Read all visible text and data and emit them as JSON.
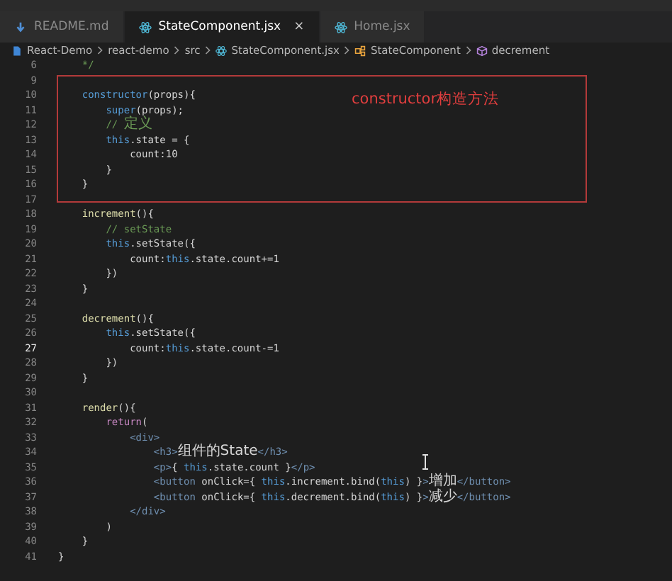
{
  "tabs": [
    {
      "label": "README.md",
      "kind": "md",
      "selected": false
    },
    {
      "label": "StateComponent.jsx",
      "kind": "jsx",
      "selected": true,
      "close": "×"
    },
    {
      "label": "Home.jsx",
      "kind": "jsx",
      "selected": false
    }
  ],
  "breadcrumb": [
    {
      "label": "React-Demo",
      "kind": "file"
    },
    {
      "label": "react-demo",
      "kind": "plain"
    },
    {
      "label": "src",
      "kind": "plain"
    },
    {
      "label": "StateComponent.jsx",
      "kind": "jsx"
    },
    {
      "label": "StateComponent",
      "kind": "class"
    },
    {
      "label": "decrement",
      "kind": "method"
    }
  ],
  "annotation": {
    "text": "constructor构造方法"
  },
  "code_lines": [
    {
      "n": "6",
      "active": false,
      "tokens": [
        {
          "t": "    */",
          "kind": "comment"
        }
      ]
    },
    {
      "n": "9",
      "active": false
    },
    {
      "n": "10",
      "active": false,
      "tokens": [
        {
          "t": "    constructor",
          "kind": "kw"
        },
        {
          "t": "(props){",
          "kind": "plain"
        }
      ]
    },
    {
      "n": "11",
      "active": false,
      "tokens": [
        {
          "t": "        super",
          "kind": "kw"
        },
        {
          "t": "(props);",
          "kind": "plain"
        }
      ]
    },
    {
      "n": "12",
      "active": false,
      "tokens": [
        {
          "t": "        // ",
          "kind": "comment"
        },
        {
          "t": "定义",
          "kind": "comment"
        }
      ]
    },
    {
      "n": "13",
      "active": false,
      "tokens": [
        {
          "t": "        this",
          "kind": "kw"
        },
        {
          "t": ".state = {",
          "kind": "plain"
        }
      ]
    },
    {
      "n": "14",
      "active": false,
      "tokens": [
        {
          "t": "            count:10",
          "kind": "plain"
        }
      ]
    },
    {
      "n": "15",
      "active": false,
      "tokens": [
        {
          "t": "        }",
          "kind": "plain"
        }
      ]
    },
    {
      "n": "16",
      "active": false,
      "tokens": [
        {
          "t": "    }",
          "kind": "plain"
        }
      ]
    },
    {
      "n": "17",
      "active": false
    },
    {
      "n": "18",
      "active": false,
      "tokens": [
        {
          "t": "    increment",
          "kind": "fn"
        },
        {
          "t": "(){",
          "kind": "plain"
        }
      ]
    },
    {
      "n": "19",
      "active": false,
      "tokens": [
        {
          "t": "        // setState",
          "kind": "comment"
        }
      ]
    },
    {
      "n": "20",
      "active": false,
      "tokens": [
        {
          "t": "        this",
          "kind": "kw"
        },
        {
          "t": ".setState({",
          "kind": "plain"
        }
      ]
    },
    {
      "n": "21",
      "active": false,
      "tokens": [
        {
          "t": "            count:",
          "kind": "plain"
        },
        {
          "t": "this",
          "kind": "kw"
        },
        {
          "t": ".state.count+=1",
          "kind": "plain"
        }
      ]
    },
    {
      "n": "22",
      "active": false,
      "tokens": [
        {
          "t": "        })",
          "kind": "plain"
        }
      ]
    },
    {
      "n": "23",
      "active": false,
      "tokens": [
        {
          "t": "    }",
          "kind": "plain"
        }
      ]
    },
    {
      "n": "24",
      "active": false
    },
    {
      "n": "25",
      "active": false,
      "tokens": [
        {
          "t": "    decrement",
          "kind": "fn"
        },
        {
          "t": "(){",
          "kind": "plain"
        }
      ]
    },
    {
      "n": "26",
      "active": false,
      "tokens": [
        {
          "t": "        this",
          "kind": "kw"
        },
        {
          "t": ".setState({",
          "kind": "plain"
        }
      ]
    },
    {
      "n": "27",
      "active": true,
      "tokens": [
        {
          "t": "            count:",
          "kind": "plain"
        },
        {
          "t": "this",
          "kind": "kw"
        },
        {
          "t": ".state.count-=1",
          "kind": "plain"
        }
      ]
    },
    {
      "n": "28",
      "active": false,
      "tokens": [
        {
          "t": "        })",
          "kind": "plain"
        }
      ]
    },
    {
      "n": "29",
      "active": false,
      "tokens": [
        {
          "t": "    }",
          "kind": "plain"
        }
      ]
    },
    {
      "n": "30",
      "active": false
    },
    {
      "n": "31",
      "active": false,
      "tokens": [
        {
          "t": "    render",
          "kind": "fn"
        },
        {
          "t": "(){",
          "kind": "plain"
        }
      ]
    },
    {
      "n": "32",
      "active": false,
      "tokens": [
        {
          "t": "        return",
          "kind": "ctl"
        },
        {
          "t": "(",
          "kind": "plain"
        }
      ]
    },
    {
      "n": "33",
      "active": false,
      "tokens": [
        {
          "t": "            <div>",
          "kind": "tag"
        }
      ]
    },
    {
      "n": "34",
      "active": false,
      "tokens": [
        {
          "t": "                <h3>",
          "kind": "tag"
        },
        {
          "t": "组件的State",
          "kind": "plain"
        },
        {
          "t": "</h3>",
          "kind": "tag"
        }
      ]
    },
    {
      "n": "35",
      "active": false,
      "tokens": [
        {
          "t": "                <p>",
          "kind": "tag"
        },
        {
          "t": "{ ",
          "kind": "plain"
        },
        {
          "t": "this",
          "kind": "kw"
        },
        {
          "t": ".state.count }",
          "kind": "plain"
        },
        {
          "t": "</p>",
          "kind": "tag"
        }
      ]
    },
    {
      "n": "36",
      "active": false,
      "tokens": [
        {
          "t": "                <button",
          "kind": "tag"
        },
        {
          "t": " onClick={ ",
          "kind": "plain"
        },
        {
          "t": "this",
          "kind": "kw"
        },
        {
          "t": ".increment.bind(",
          "kind": "plain"
        },
        {
          "t": "this",
          "kind": "kw"
        },
        {
          "t": ") }",
          "kind": "plain"
        },
        {
          "t": ">",
          "kind": "tag"
        },
        {
          "t": "增加",
          "kind": "plain"
        },
        {
          "t": "</button>",
          "kind": "tag"
        }
      ]
    },
    {
      "n": "37",
      "active": false,
      "tokens": [
        {
          "t": "                <button",
          "kind": "tag"
        },
        {
          "t": " onClick={ ",
          "kind": "plain"
        },
        {
          "t": "this",
          "kind": "kw"
        },
        {
          "t": ".decrement.bind(",
          "kind": "plain"
        },
        {
          "t": "this",
          "kind": "kw"
        },
        {
          "t": ") }",
          "kind": "plain"
        },
        {
          "t": ">",
          "kind": "tag"
        },
        {
          "t": "减少",
          "kind": "plain"
        },
        {
          "t": "</button>",
          "kind": "tag"
        }
      ]
    },
    {
      "n": "38",
      "active": false,
      "tokens": [
        {
          "t": "            </div>",
          "kind": "tag"
        }
      ]
    },
    {
      "n": "39",
      "active": false,
      "tokens": [
        {
          "t": "        )",
          "kind": "plain"
        }
      ]
    },
    {
      "n": "40",
      "active": false,
      "tokens": [
        {
          "t": "    }",
          "kind": "plain"
        }
      ]
    },
    {
      "n": "41",
      "active": false,
      "tokens": [
        {
          "t": "}",
          "kind": "plain"
        }
      ]
    }
  ]
}
